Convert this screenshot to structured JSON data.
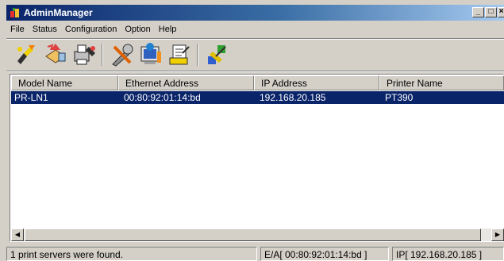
{
  "window": {
    "title": "AdminManager"
  },
  "menu": [
    "File",
    "Status",
    "Configuration",
    "Option",
    "Help"
  ],
  "toolbar": [
    "search-printers-icon",
    "network-config-icon",
    "printer-settings-icon",
    "tools-icon",
    "monitor-settings-icon",
    "printer-edit-icon",
    "color-settings-icon"
  ],
  "columns": [
    "Model Name",
    "Ethernet Address",
    "IP Address",
    "Printer Name"
  ],
  "rows": [
    {
      "model": "PR-LN1",
      "ethernet": "00:80:92:01:14:bd",
      "ip": "192.168.20.185",
      "printer": "PT390",
      "selected": true
    }
  ],
  "status": {
    "message": "1 print servers were found.",
    "ea": "E/A[ 00:80:92:01:14:bd ]",
    "ip": "IP[ 192.168.20.185 ]"
  },
  "colors": {
    "selection": "#0a246a",
    "face": "#d4d0c8"
  }
}
